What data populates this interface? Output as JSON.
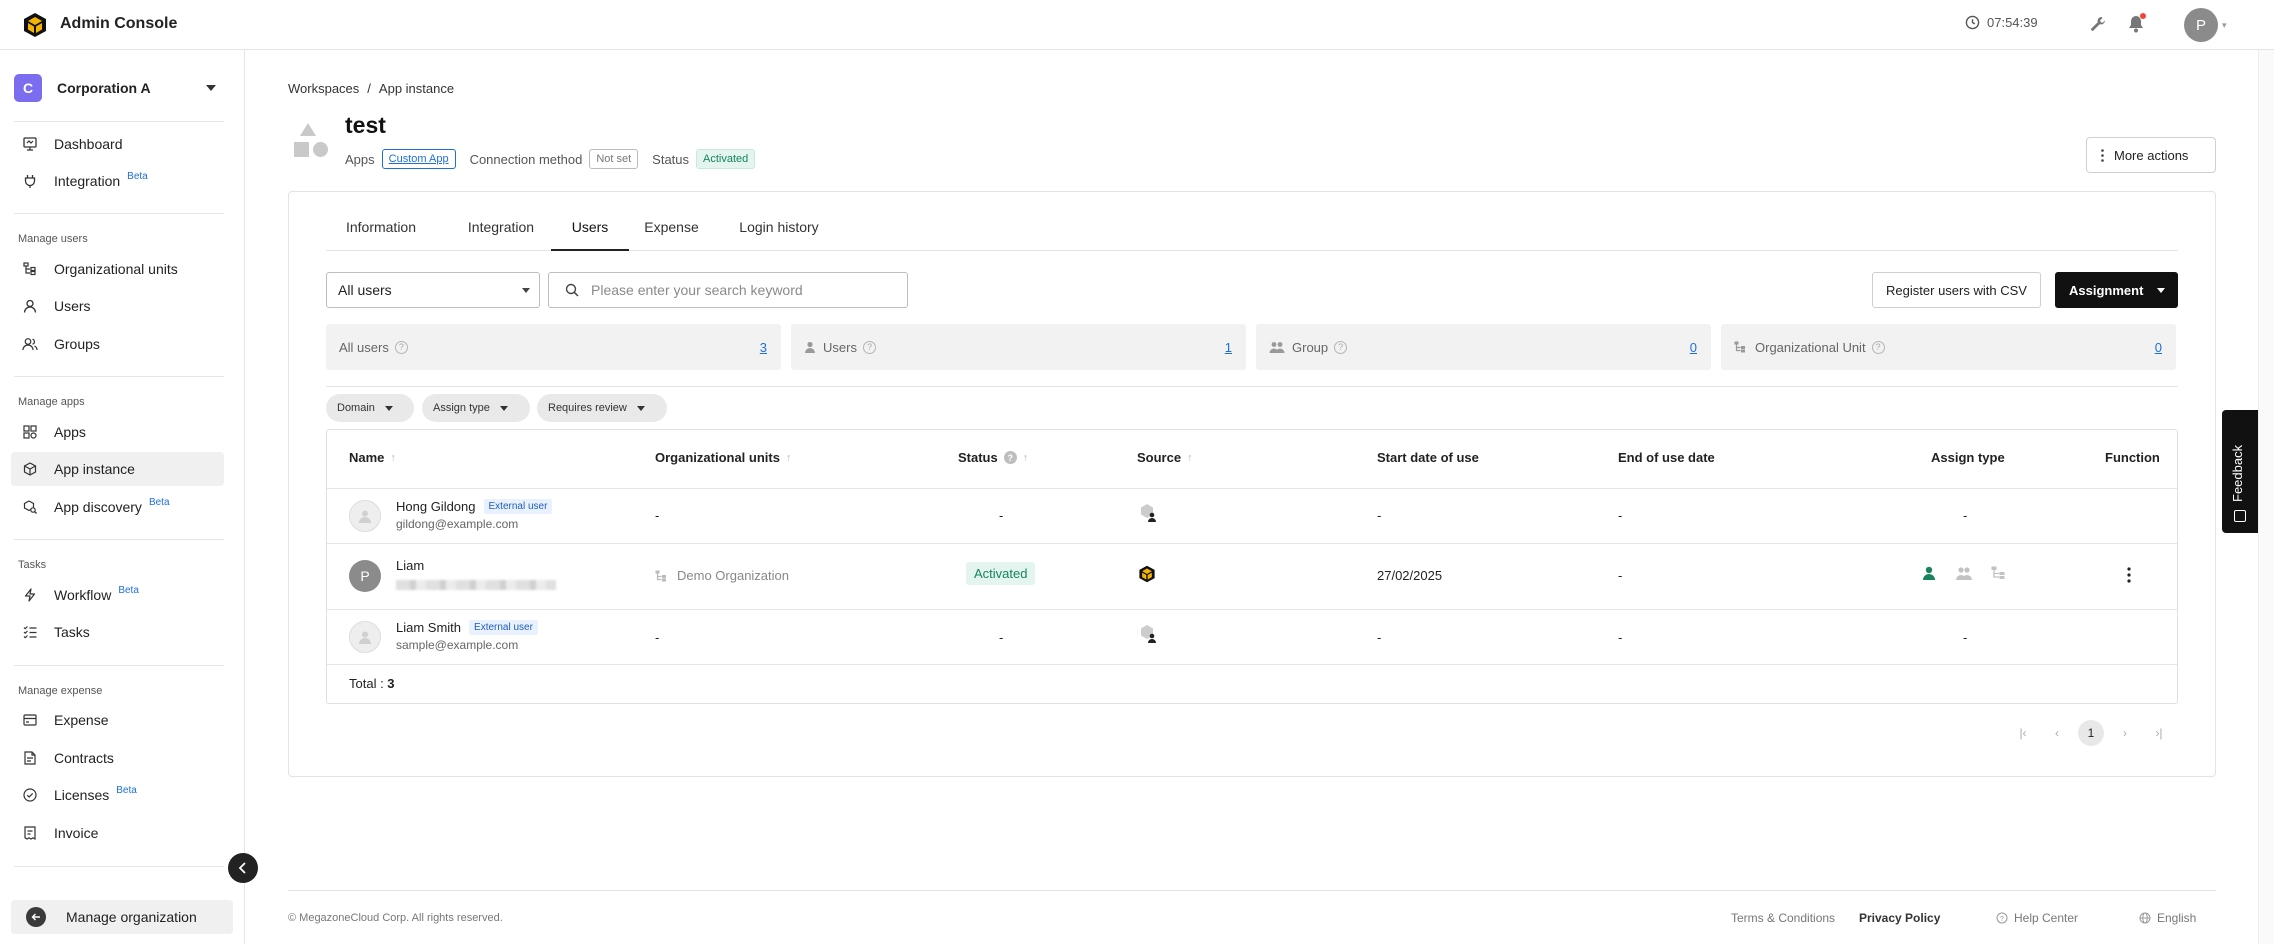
{
  "header": {
    "app_title": "Admin Console",
    "clock": "07:54:39",
    "avatar_initial": "P"
  },
  "sidebar": {
    "org_initial": "C",
    "org_name": "Corporation A",
    "top_items": [
      {
        "label": "Dashboard",
        "icon": "dashboard-icon",
        "beta": ""
      },
      {
        "label": "Integration",
        "icon": "plug-icon",
        "beta": "Beta"
      }
    ],
    "sections": [
      {
        "label": "Manage users",
        "items": [
          {
            "label": "Organizational units",
            "icon": "org-tree-icon",
            "beta": ""
          },
          {
            "label": "Users",
            "icon": "user-icon",
            "beta": ""
          },
          {
            "label": "Groups",
            "icon": "group-icon",
            "beta": ""
          }
        ]
      },
      {
        "label": "Manage apps",
        "items": [
          {
            "label": "Apps",
            "icon": "apps-grid-icon",
            "beta": ""
          },
          {
            "label": "App instance",
            "icon": "cube-icon",
            "beta": ""
          },
          {
            "label": "App discovery",
            "icon": "search-apps-icon",
            "beta": "Beta"
          }
        ]
      },
      {
        "label": "Tasks",
        "items": [
          {
            "label": "Workflow",
            "icon": "bolt-icon",
            "beta": "Beta"
          },
          {
            "label": "Tasks",
            "icon": "checklist-icon",
            "beta": ""
          }
        ]
      },
      {
        "label": "Manage expense",
        "items": [
          {
            "label": "Expense",
            "icon": "card-icon",
            "beta": ""
          },
          {
            "label": "Contracts",
            "icon": "contract-icon",
            "beta": ""
          },
          {
            "label": "Licenses",
            "icon": "license-icon",
            "beta": "Beta"
          },
          {
            "label": "Invoice",
            "icon": "invoice-icon",
            "beta": ""
          }
        ]
      }
    ],
    "active_item": "App instance",
    "manage_org_label": "Manage organization"
  },
  "breadcrumb": {
    "parent": "Workspaces",
    "sep": "/",
    "current": "App instance"
  },
  "app": {
    "name": "test",
    "apps_label": "Apps",
    "apps_value": "Custom App",
    "connection_label": "Connection method",
    "connection_value": "Not set",
    "status_label": "Status",
    "status_value": "Activated"
  },
  "more_actions_label": "More actions",
  "tabs": [
    "Information",
    "Integration",
    "Users",
    "Expense",
    "Login history"
  ],
  "active_tab": "Users",
  "toolbar": {
    "filter_value": "All users",
    "search_placeholder": "Please enter your search keyword",
    "csv_label": "Register users with CSV",
    "assign_label": "Assignment"
  },
  "stats": [
    {
      "label": "All users",
      "value": "3"
    },
    {
      "label": "Users",
      "value": "1"
    },
    {
      "label": "Group",
      "value": "0"
    },
    {
      "label": "Organizational Unit",
      "value": "0"
    }
  ],
  "chips": [
    "Domain",
    "Assign type",
    "Requires review"
  ],
  "table": {
    "columns": [
      "Name",
      "Organizational units",
      "Status",
      "Source",
      "Start date of use",
      "End of use date",
      "Assign type",
      "Function"
    ],
    "rows": [
      {
        "name": "Hong Gildong",
        "badge": "External user",
        "email": "gildong@example.com",
        "org": "-",
        "status": "-",
        "start": "-",
        "end": "-",
        "assign": "-"
      },
      {
        "name": "Liam",
        "avatar": "P",
        "badge": "",
        "email": "",
        "org": "Demo Organization",
        "status": "Activated",
        "start": "27/02/2025",
        "end": "-",
        "assign": ""
      },
      {
        "name": "Liam Smith",
        "badge": "External user",
        "email": "sample@example.com",
        "org": "-",
        "status": "-",
        "start": "-",
        "end": "-",
        "assign": "-"
      }
    ],
    "total_label": "Total : ",
    "total_value": "3"
  },
  "pagination": {
    "current": "1"
  },
  "footer": {
    "copyright": "© MegazoneCloud Corp. All rights reserved.",
    "terms": "Terms & Conditions",
    "privacy": "Privacy Policy",
    "help": "Help Center",
    "language": "English"
  },
  "feedback_label": "Feedback",
  "colors": {
    "accent_link": "#1e6fd9",
    "status_green": "#17845c",
    "org_badge": "#7c6df0"
  }
}
